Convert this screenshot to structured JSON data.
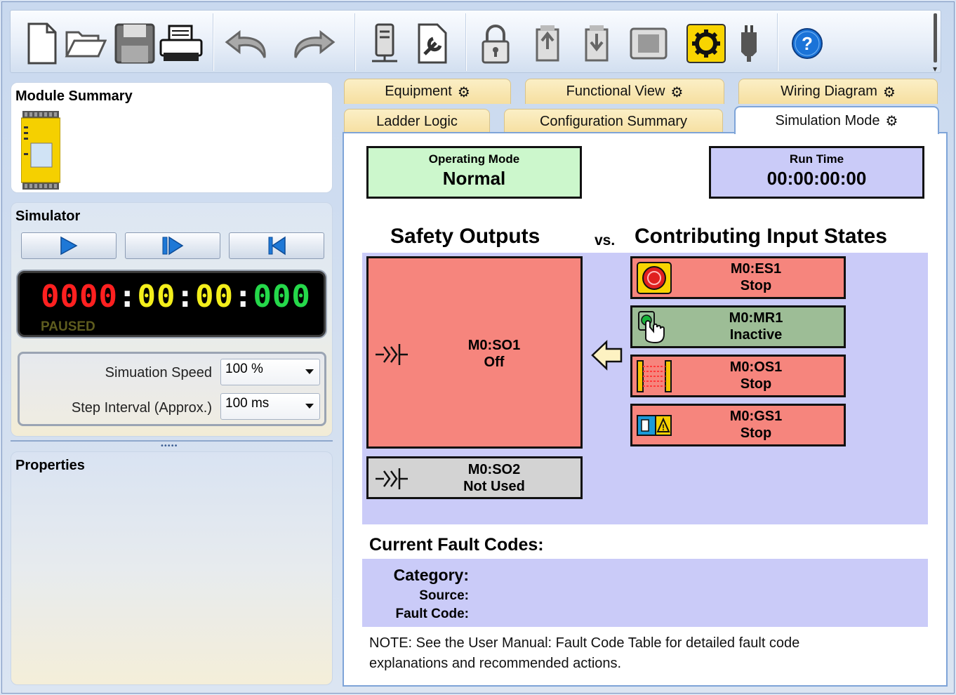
{
  "toolbar": {
    "icons": [
      "new-file-icon",
      "open-folder-icon",
      "save-icon",
      "print-icon",
      "undo-icon",
      "redo-icon",
      "network-device-icon",
      "configure-device-icon",
      "lock-icon",
      "module-write-icon",
      "module-read-icon",
      "module-view-icon",
      "simulation-gear-icon",
      "usb-plug-icon",
      "help-icon"
    ]
  },
  "module_summary": {
    "title": "Module Summary"
  },
  "simulator": {
    "title": "Simulator",
    "clock": {
      "hours": "0000",
      "minutes": "00",
      "seconds": "00",
      "millis": "000",
      "sep": ":"
    },
    "status": "PAUSED",
    "speed_label": "Simuation Speed",
    "speed_value": "100 %",
    "interval_label": "Step Interval (Approx.)",
    "interval_value": "100 ms"
  },
  "properties": {
    "title": "Properties"
  },
  "tabs": {
    "row1": [
      "Equipment",
      "Functional View",
      "Wiring Diagram"
    ],
    "row2": [
      "Ladder Logic",
      "Configuration Summary",
      "Simulation Mode"
    ]
  },
  "simulation": {
    "operating_mode_label": "Operating Mode",
    "operating_mode_value": "Normal",
    "run_time_label": "Run Time",
    "run_time_value": "00:00:00:00",
    "safety_outputs_heading": "Safety Outputs",
    "vs": "vs.",
    "inputs_heading": "Contributing Input States",
    "outputs": [
      {
        "name": "M0:SO1",
        "state": "Off"
      },
      {
        "name": "M0:SO2",
        "state": "Not Used"
      }
    ],
    "inputs": [
      {
        "name": "M0:ES1",
        "state": "Stop",
        "icon": "emergency-stop-icon"
      },
      {
        "name": "M0:MR1",
        "state": "Inactive",
        "icon": "manual-reset-icon"
      },
      {
        "name": "M0:OS1",
        "state": "Stop",
        "icon": "light-curtain-icon"
      },
      {
        "name": "M0:GS1",
        "state": "Stop",
        "icon": "gate-switch-icon"
      }
    ],
    "fault_title": "Current Fault Codes:",
    "fault_category": "Category:",
    "fault_source": "Source:",
    "fault_code": "Fault Code:",
    "note": "NOTE: See the User Manual: Fault Code Table for detailed fault code explanations and recommended actions."
  },
  "colors": {
    "stop_red": "#f6857d",
    "inactive_green": "#9dbd96",
    "not_used_gray": "#d3d3d3",
    "normal_green": "#ccf7cc",
    "run_time_lavender": "#cacbf8",
    "panel_lavender": "#cacbf8",
    "tab_tan": "#f8e4a8"
  }
}
